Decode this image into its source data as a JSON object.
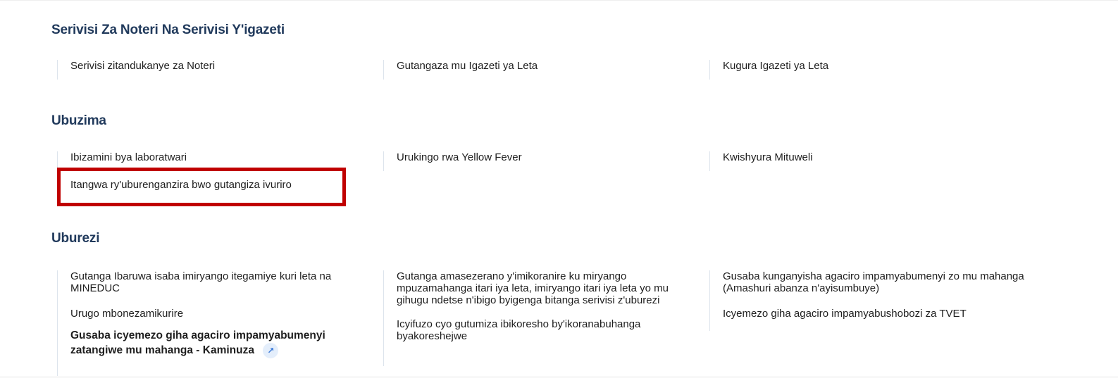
{
  "sections": [
    {
      "title": "Serivisi Za Noteri Na Serivisi Y'igazeti",
      "columns": [
        [
          "Serivisi zitandukanye za Noteri"
        ],
        [
          "Gutangaza mu Igazeti ya Leta"
        ],
        [
          "Kugura Igazeti ya Leta"
        ]
      ]
    },
    {
      "title": "Ubuzima",
      "columns": [
        [
          "Ibizamini bya laboratwari",
          "Itangwa ry'uburenganzira bwo gutangiza ivuriro"
        ],
        [
          "Urukingo rwa Yellow Fever"
        ],
        [
          "Kwishyura Mituweli"
        ]
      ]
    },
    {
      "title": "Uburezi",
      "columns": [
        [
          "Gutanga Ibaruwa isaba imiryango itegamiye kuri leta na MINEDUC",
          "Urugo mbonezamikurire",
          "Gusaba icyemezo giha agaciro impamyabumenyi zatangiwe mu mahanga - Kaminuza"
        ],
        [
          "Gutanga amasezerano y'imikoranire ku miryango mpuzamahanga itari iya leta, imiryango itari iya leta yo mu gihugu ndetse n'ibigo byigenga bitanga serivisi z'uburezi",
          "Icyifuzo cyo gutumiza ibikoresho by'ikoranabuhanga byakoreshejwe"
        ],
        [
          "Gusaba kunganyisha agaciro impamyabumenyi zo mu mahanga (Amashuri abanza n'ayisumbuye)",
          "Icyemezo giha agaciro impamyabushobozi za TVET"
        ]
      ]
    }
  ],
  "highlight_color": "#c00000",
  "icons": {
    "external_link": "arrow-up-right-icon"
  }
}
